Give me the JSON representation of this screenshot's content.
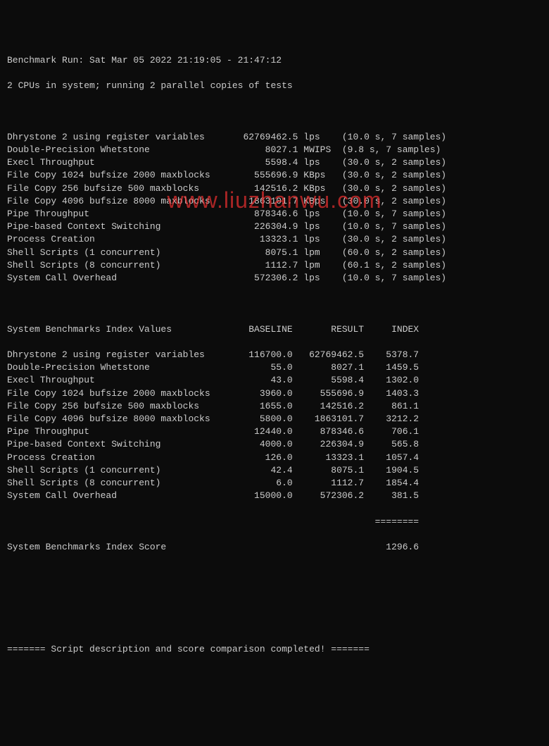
{
  "header": {
    "line1": "Benchmark Run: Sat Mar 05 2022 21:19:05 - 21:47:12",
    "line2": "2 CPUs in system; running 2 parallel copies of tests"
  },
  "tests": [
    {
      "name": "Dhrystone 2 using register variables",
      "value": "62769462.5",
      "unit": "lps",
      "timing": "(10.0 s, 7 samples)"
    },
    {
      "name": "Double-Precision Whetstone",
      "value": "8027.1",
      "unit": "MWIPS",
      "timing": "(9.8 s, 7 samples)"
    },
    {
      "name": "Execl Throughput",
      "value": "5598.4",
      "unit": "lps",
      "timing": "(30.0 s, 2 samples)"
    },
    {
      "name": "File Copy 1024 bufsize 2000 maxblocks",
      "value": "555696.9",
      "unit": "KBps",
      "timing": "(30.0 s, 2 samples)"
    },
    {
      "name": "File Copy 256 bufsize 500 maxblocks",
      "value": "142516.2",
      "unit": "KBps",
      "timing": "(30.0 s, 2 samples)"
    },
    {
      "name": "File Copy 4096 bufsize 8000 maxblocks",
      "value": "1863101.7",
      "unit": "KBps",
      "timing": "(30.0 s, 2 samples)"
    },
    {
      "name": "Pipe Throughput",
      "value": "878346.6",
      "unit": "lps",
      "timing": "(10.0 s, 7 samples)"
    },
    {
      "name": "Pipe-based Context Switching",
      "value": "226304.9",
      "unit": "lps",
      "timing": "(10.0 s, 7 samples)"
    },
    {
      "name": "Process Creation",
      "value": "13323.1",
      "unit": "lps",
      "timing": "(30.0 s, 2 samples)"
    },
    {
      "name": "Shell Scripts (1 concurrent)",
      "value": "8075.1",
      "unit": "lpm",
      "timing": "(60.0 s, 2 samples)"
    },
    {
      "name": "Shell Scripts (8 concurrent)",
      "value": "1112.7",
      "unit": "lpm",
      "timing": "(60.1 s, 2 samples)"
    },
    {
      "name": "System Call Overhead",
      "value": "572306.2",
      "unit": "lps",
      "timing": "(10.0 s, 7 samples)"
    }
  ],
  "index_header": {
    "title": "System Benchmarks Index Values",
    "col1": "BASELINE",
    "col2": "RESULT",
    "col3": "INDEX"
  },
  "index_rows": [
    {
      "name": "Dhrystone 2 using register variables",
      "baseline": "116700.0",
      "result": "62769462.5",
      "index": "5378.7"
    },
    {
      "name": "Double-Precision Whetstone",
      "baseline": "55.0",
      "result": "8027.1",
      "index": "1459.5"
    },
    {
      "name": "Execl Throughput",
      "baseline": "43.0",
      "result": "5598.4",
      "index": "1302.0"
    },
    {
      "name": "File Copy 1024 bufsize 2000 maxblocks",
      "baseline": "3960.0",
      "result": "555696.9",
      "index": "1403.3"
    },
    {
      "name": "File Copy 256 bufsize 500 maxblocks",
      "baseline": "1655.0",
      "result": "142516.2",
      "index": "861.1"
    },
    {
      "name": "File Copy 4096 bufsize 8000 maxblocks",
      "baseline": "5800.0",
      "result": "1863101.7",
      "index": "3212.2"
    },
    {
      "name": "Pipe Throughput",
      "baseline": "12440.0",
      "result": "878346.6",
      "index": "706.1"
    },
    {
      "name": "Pipe-based Context Switching",
      "baseline": "4000.0",
      "result": "226304.9",
      "index": "565.8"
    },
    {
      "name": "Process Creation",
      "baseline": "126.0",
      "result": "13323.1",
      "index": "1057.4"
    },
    {
      "name": "Shell Scripts (1 concurrent)",
      "baseline": "42.4",
      "result": "8075.1",
      "index": "1904.5"
    },
    {
      "name": "Shell Scripts (8 concurrent)",
      "baseline": "6.0",
      "result": "1112.7",
      "index": "1854.4"
    },
    {
      "name": "System Call Overhead",
      "baseline": "15000.0",
      "result": "572306.2",
      "index": "381.5"
    }
  ],
  "divider": "                                                                   ========",
  "score": {
    "label": "System Benchmarks Index Score",
    "value": "1296.6"
  },
  "footer": "======= Script description and score comparison completed! =======",
  "watermark": "www.liuzhanwu.com"
}
